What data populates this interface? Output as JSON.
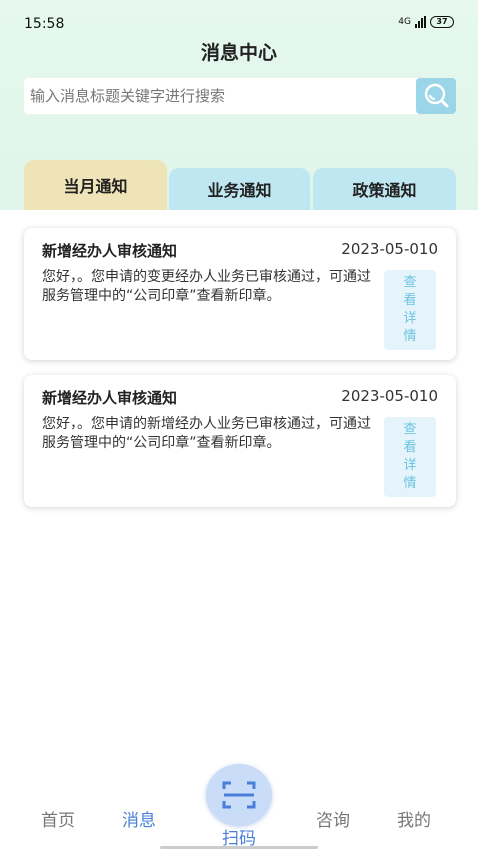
{
  "status": {
    "time": "15:58",
    "network": "4G",
    "battery": "37"
  },
  "header": {
    "title": "消息中心"
  },
  "search": {
    "placeholder": "输入消息标题关键字进行搜索"
  },
  "tabs": [
    {
      "label": "当月通知",
      "active": true
    },
    {
      "label": "业务通知",
      "active": false
    },
    {
      "label": "政策通知",
      "active": false
    }
  ],
  "messages": [
    {
      "title": "新增经办人审核通知",
      "date": "2023-05-010",
      "body": "您好，。您申请的变更经办人业务已审核通过，可通过服务管理中的“公司印章”查看新印章。",
      "detail_label": [
        "查",
        "看",
        "详",
        "情"
      ]
    },
    {
      "title": "新增经办人审核通知",
      "date": "2023-05-010",
      "body": "您好，。您申请的新增经办人业务已审核通过，可通过服务管理中的“公司印章”查看新印章。",
      "detail_label": [
        "查",
        "看",
        "详",
        "情"
      ]
    }
  ],
  "bottom_nav": {
    "home": "首页",
    "messages": "消息",
    "scan": "扫码",
    "consult": "咨询",
    "mine": "我的"
  },
  "colors": {
    "accent": "#4a7fd9",
    "tab_active": "#efe4b8",
    "tab_inactive": "#bfe7f2",
    "detail_text": "#6cc3e0"
  }
}
